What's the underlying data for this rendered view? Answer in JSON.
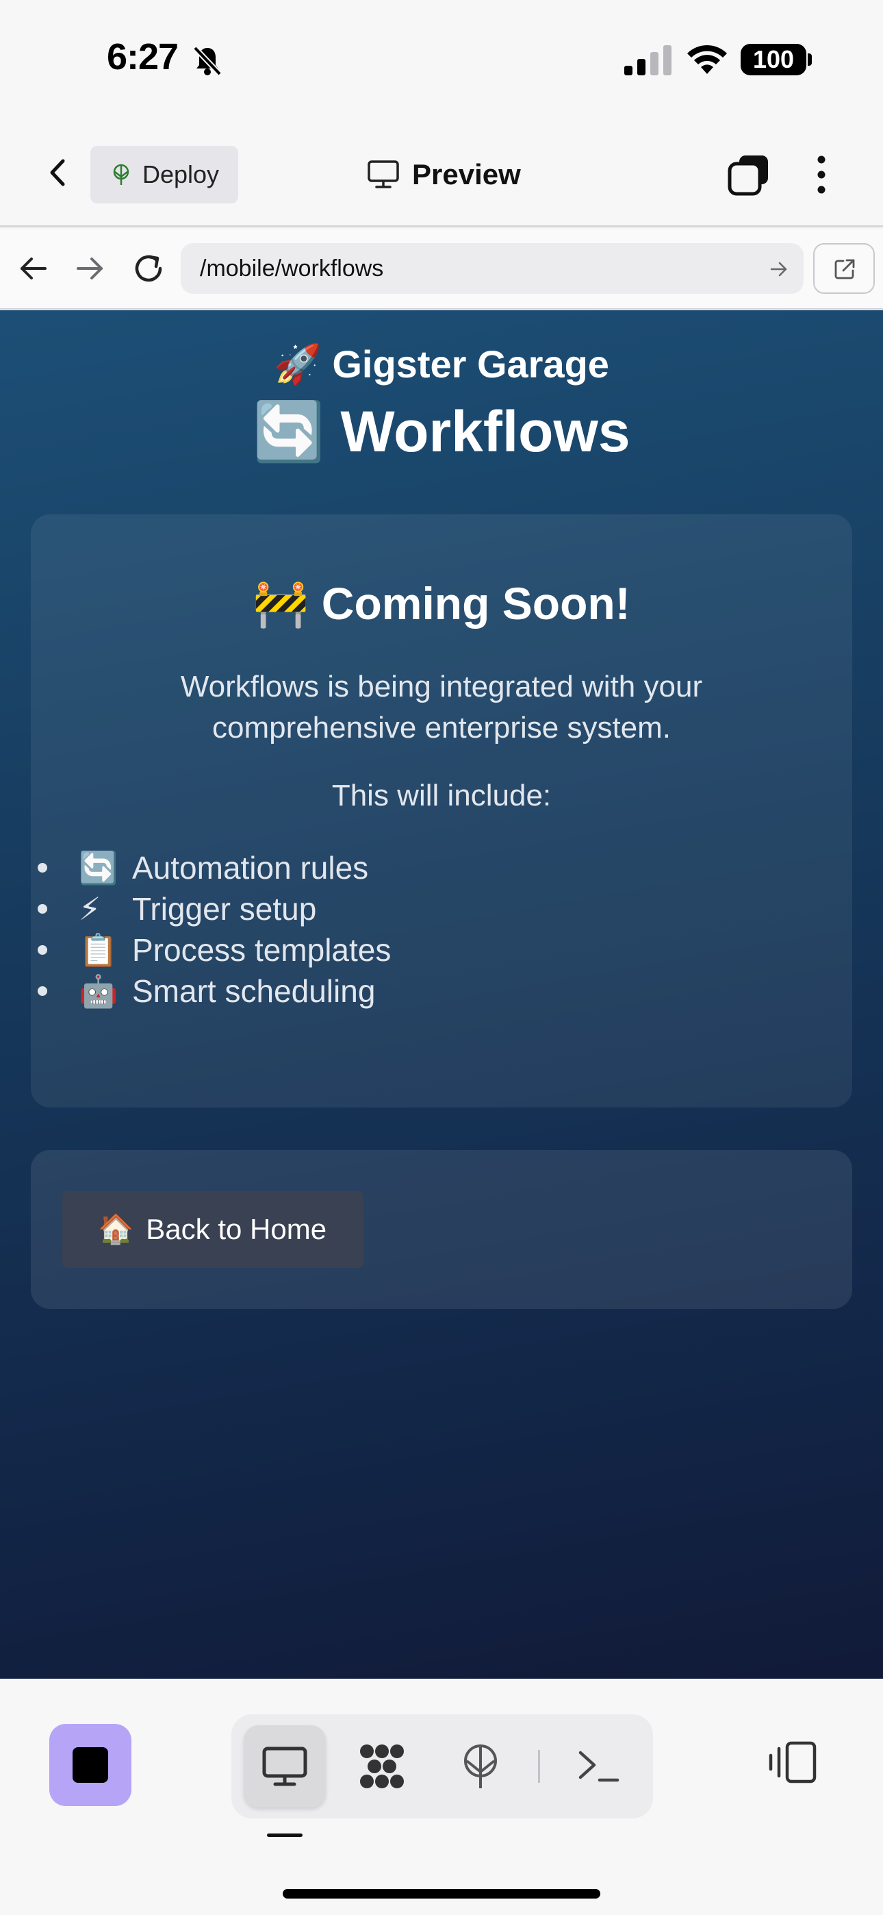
{
  "status_bar": {
    "time": "6:27",
    "battery": "100"
  },
  "toolbar": {
    "deploy_label": "Deploy",
    "preview_label": "Preview"
  },
  "browser": {
    "url": "/mobile/workflows"
  },
  "page": {
    "brand_emoji": "🚀",
    "brand": "Gigster Garage",
    "heading_emoji": "🔄",
    "heading": "Workflows",
    "card": {
      "title_emoji": "🚧",
      "title": "Coming Soon!",
      "description": "Workflows is being integrated with your comprehensive enterprise system.",
      "subheading": "This will include:",
      "features": [
        {
          "emoji": "🔄",
          "label": "Automation rules"
        },
        {
          "emoji": "⚡",
          "label": "Trigger setup"
        },
        {
          "emoji": "📋",
          "label": "Process templates"
        },
        {
          "emoji": "🤖",
          "label": "Smart scheduling"
        }
      ]
    },
    "home_button_emoji": "🏠",
    "home_button": "Back to Home"
  },
  "colors": {
    "accent": "#b6a4f7",
    "content_bg_top": "#1d4f76",
    "content_bg_bottom": "#111a38",
    "button_bg": "#3a4152"
  }
}
